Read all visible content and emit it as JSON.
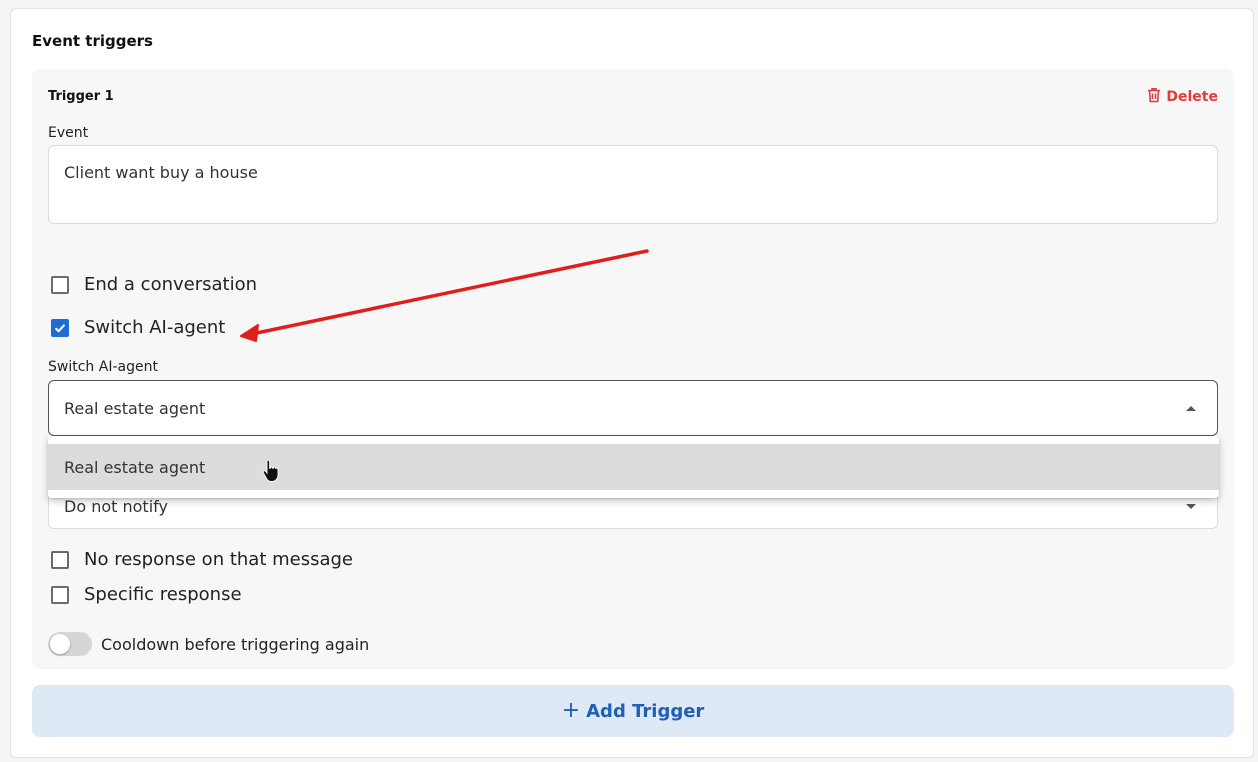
{
  "section": {
    "title": "Event triggers"
  },
  "trigger": {
    "title": "Trigger 1",
    "delete_label": "Delete",
    "event_label": "Event",
    "event_value": "Client want buy a house",
    "end_conversation_label": "End a conversation",
    "switch_agent_checkbox_label": "Switch AI-agent",
    "switch_agent_field_label": "Switch AI-agent",
    "switch_agent_value": "Real estate agent",
    "dropdown_options": [
      "Real estate agent"
    ],
    "notify_value": "Do not notify",
    "no_response_label": "No response on that message",
    "specific_response_label": "Specific response",
    "cooldown_label": "Cooldown before triggering again"
  },
  "add_trigger": {
    "plus": "+",
    "label": "Add Trigger"
  },
  "colors": {
    "accent": "#1f6bd1",
    "danger": "#e23b3b",
    "annotation_arrow": "#e11d1d",
    "add_button_bg": "#dfe8f5"
  },
  "state": {
    "end_conversation_checked": false,
    "switch_agent_checked": true,
    "no_response_checked": false,
    "specific_response_checked": false,
    "cooldown_enabled": false,
    "dropdown_open": true
  }
}
